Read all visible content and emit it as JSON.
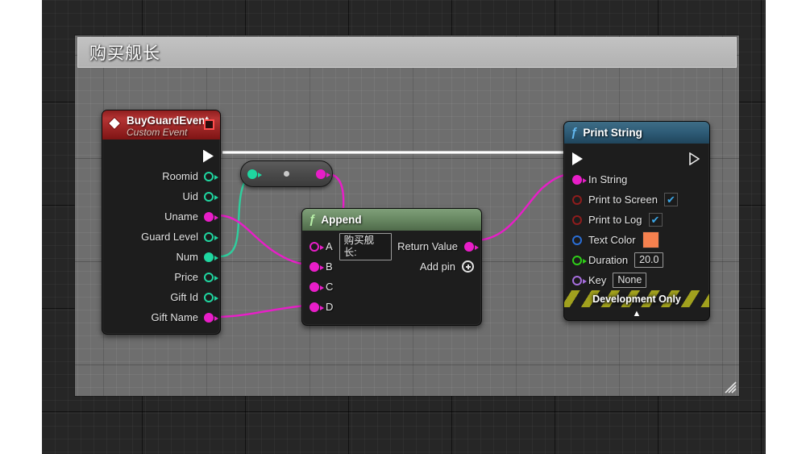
{
  "window": {
    "title": "购买舰长",
    "resize_grip": "resize-grip"
  },
  "canvas": {
    "background_color": "#262626",
    "panel_color": "#6e6e6e",
    "grid": "on"
  },
  "nodes": {
    "event": {
      "title": "BuyGuardEvent",
      "subtitle": "Custom Event",
      "header_color": "#b53434",
      "icon": "diamond-icon",
      "collapse_button": "red-square-button",
      "exec_out": "exec-output-pin",
      "pins": [
        {
          "label": "Roomid",
          "color": "#1fd6a0",
          "connected": false
        },
        {
          "label": "Uid",
          "color": "#1fd6a0",
          "connected": false
        },
        {
          "label": "Uname",
          "color": "#e81ec8",
          "connected": true
        },
        {
          "label": "Guard Level",
          "color": "#1fd6a0",
          "connected": false
        },
        {
          "label": "Num",
          "color": "#1fd6a0",
          "connected": true
        },
        {
          "label": "Price",
          "color": "#1fd6a0",
          "connected": false
        },
        {
          "label": "Gift Id",
          "color": "#1fd6a0",
          "connected": false
        },
        {
          "label": "Gift Name",
          "color": "#e81ec8",
          "connected": true
        }
      ]
    },
    "knot": {
      "name": "conversion-node",
      "input_color": "#1fd6a0",
      "output_color": "#e81ec8"
    },
    "append": {
      "title": "Append",
      "icon": "function-icon",
      "header_color": "#6a8a64",
      "inputs": [
        {
          "label": "A",
          "color": "#e81ec8",
          "connected": false,
          "value": "购买舰长:"
        },
        {
          "label": "B",
          "color": "#e81ec8",
          "connected": true
        },
        {
          "label": "C",
          "color": "#e81ec8",
          "connected": true
        },
        {
          "label": "D",
          "color": "#e81ec8",
          "connected": true
        }
      ],
      "outputs": [
        {
          "label": "Return Value",
          "color": "#e81ec8",
          "connected": true
        }
      ],
      "add_pin_label": "Add pin"
    },
    "print": {
      "title": "Print String",
      "icon": "function-icon",
      "header_color": "#2f5d78",
      "rows": [
        {
          "label": "In String",
          "color": "#e81ec8",
          "connected": true,
          "widget": "none"
        },
        {
          "label": "Print to Screen",
          "color": "#8f1d1d",
          "connected": false,
          "widget": "checkbox",
          "value": "✔"
        },
        {
          "label": "Print to Log",
          "color": "#8f1d1d",
          "connected": false,
          "widget": "checkbox",
          "value": "✔"
        },
        {
          "label": "Text Color",
          "color": "#2a6ed6",
          "connected": false,
          "widget": "swatch",
          "value": "#f5814f"
        },
        {
          "label": "Duration",
          "color": "#2fcf18",
          "connected": false,
          "widget": "textbox",
          "value": "20.0"
        },
        {
          "label": "Key",
          "color": "#a76ddf",
          "connected": false,
          "widget": "textbox",
          "value": "None"
        }
      ],
      "footer_label": "Development Only",
      "collapse_icon": "chevron-up-icon"
    }
  }
}
